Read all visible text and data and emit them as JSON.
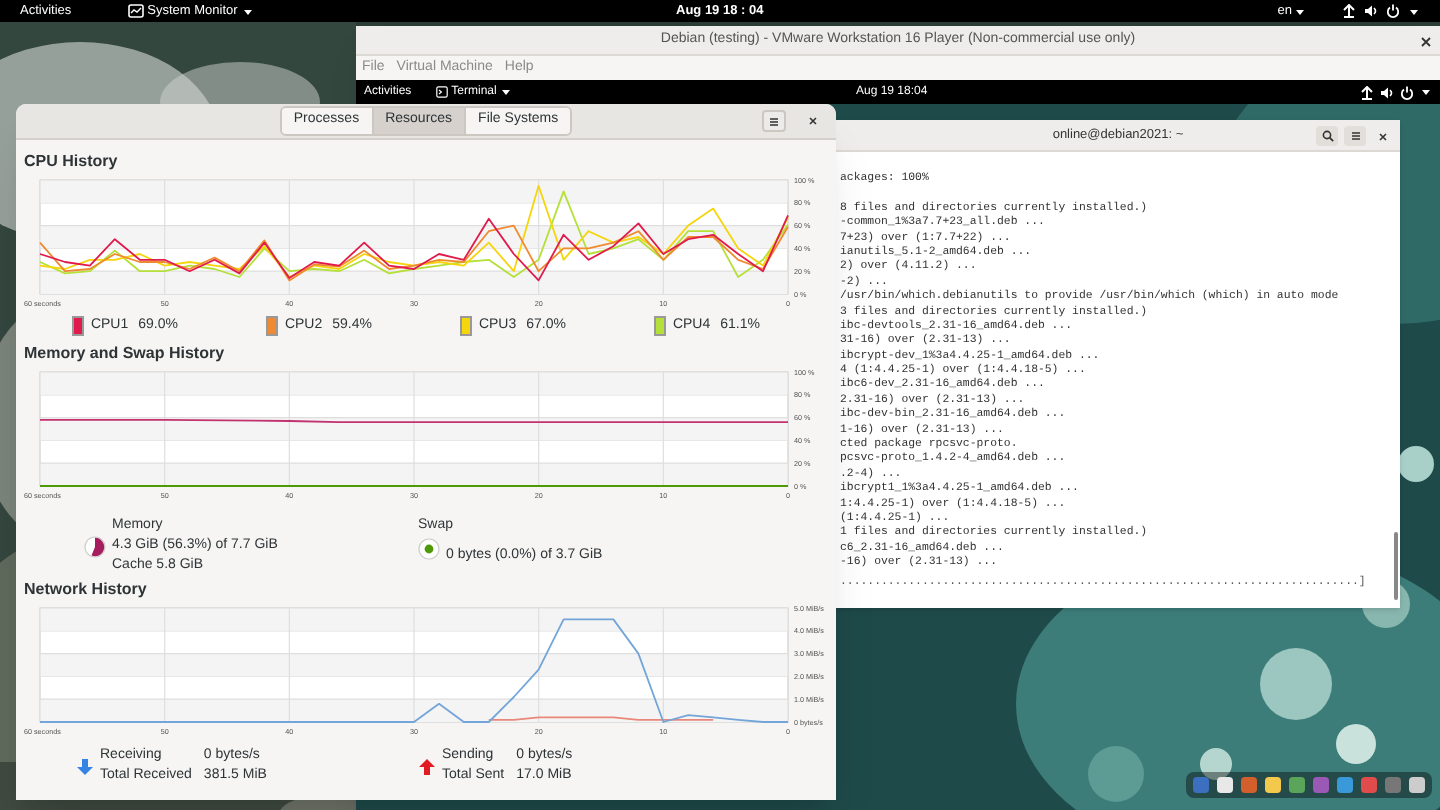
{
  "top_bar": {
    "activities": "Activities",
    "app_menu": "System Monitor",
    "clock": "Aug 19  18 : 04",
    "language": "en"
  },
  "vmware": {
    "title": "Debian (testing) - VMware Workstation 16 Player (Non-commercial use only)",
    "menu": [
      "File",
      "Virtual Machine",
      "Help"
    ],
    "guest_bar": {
      "activities": "Activities",
      "app_menu": "Terminal",
      "clock": "Aug 19  18:04"
    },
    "terminal": {
      "title": "online@debian2021: ~",
      "blocks": [
        [
          "ackages: 100%"
        ],
        [
          "8 files and directories currently installed.)",
          "-common_1%3a7.7+23_all.deb ...",
          "7+23) over (1:7.7+22) ...",
          "ianutils_5.1-2_amd64.deb ...",
          "2) over (4.11.2) ...",
          "-2) ...",
          "/usr/bin/which.debianutils to provide /usr/bin/which (which) in auto mode",
          "3 files and directories currently installed.)",
          "ibc-devtools_2.31-16_amd64.deb ...",
          "31-16) over (2.31-13) ...",
          "ibcrypt-dev_1%3a4.4.25-1_amd64.deb ...",
          "4 (1:4.4.25-1) over (1:4.4.18-5) ...",
          "ibc6-dev_2.31-16_amd64.deb ...",
          "2.31-16) over (2.31-13) ...",
          "ibc-dev-bin_2.31-16_amd64.deb ...",
          "1-16) over (2.31-13) ...",
          "cted package rpcsvc-proto.",
          "pcsvc-proto_1.4.2-4_amd64.deb ...",
          ".2-4) ...",
          "ibcrypt1_1%3a4.4.25-1_amd64.deb ...",
          "1:4.4.25-1) over (1:4.4.18-5) ...",
          "(1:4.4.25-1) ...",
          "1 files and directories currently installed.)",
          "c6_2.31-16_amd64.deb ...",
          "-16) over (2.31-13) ..."
        ]
      ],
      "progress": "............................................................................]"
    }
  },
  "system_monitor": {
    "tabs": [
      {
        "label": "Processes",
        "selected": false
      },
      {
        "label": "Resources",
        "selected": true
      },
      {
        "label": "File Systems",
        "selected": false
      }
    ],
    "cpu": {
      "title": "CPU History",
      "chart_data": {
        "type": "line",
        "grid": true,
        "xlim": [
          60,
          0
        ],
        "ylim": [
          0,
          100
        ],
        "x": [
          60,
          58,
          56,
          54,
          52,
          50,
          48,
          46,
          44,
          42,
          40,
          38,
          36,
          34,
          32,
          30,
          28,
          26,
          24,
          22,
          20,
          18,
          16,
          14,
          12,
          10,
          8,
          6,
          4,
          2,
          0
        ],
        "xticks": [
          {
            "value": 60,
            "label": "60 seconds"
          },
          50,
          40,
          30,
          20,
          10,
          0
        ],
        "yticks": [
          {
            "value": 0,
            "label": "0 %"
          },
          {
            "value": 20,
            "label": "20 %"
          },
          {
            "value": 40,
            "label": "40 %"
          },
          {
            "value": 60,
            "label": "60 %"
          },
          {
            "value": 80,
            "label": "80 %"
          },
          {
            "value": 100,
            "label": "100 %"
          }
        ],
        "series": [
          {
            "color": "#e01b4c",
            "values": [
              35,
              28,
              25,
              48,
              30,
              30,
              20,
              30,
              18,
              45,
              14,
              28,
              25,
              45,
              25,
              22,
              35,
              30,
              66,
              35,
              12,
              52,
              30,
              42,
              62,
              35,
              48,
              52,
              35,
              20,
              69
            ]
          },
          {
            "color": "#f08a30",
            "values": [
              45,
              20,
              22,
              35,
              28,
              28,
              22,
              32,
              20,
              47,
              12,
              26,
              24,
              38,
              22,
              25,
              30,
              28,
              55,
              60,
              20,
              40,
              40,
              45,
              55,
              30,
              50,
              50,
              30,
              22,
              59
            ]
          },
          {
            "color": "#f5d50c",
            "values": [
              25,
              22,
              30,
              30,
              35,
              25,
              28,
              25,
              22,
              42,
              15,
              25,
              22,
              35,
              28,
              25,
              28,
              25,
              45,
              20,
              95,
              30,
              55,
              45,
              50,
              35,
              60,
              75,
              40,
              25,
              67
            ]
          },
          {
            "color": "#b5e03a",
            "values": [
              28,
              18,
              20,
              38,
              20,
              20,
              25,
              22,
              15,
              40,
              20,
              22,
              20,
              30,
              18,
              22,
              25,
              28,
              30,
              15,
              30,
              90,
              35,
              40,
              48,
              30,
              55,
              55,
              15,
              30,
              61
            ]
          }
        ]
      },
      "legend": [
        {
          "label": "CPU1",
          "value": "69.0%",
          "color": "#e01b4c"
        },
        {
          "label": "CPU2",
          "value": "59.4%",
          "color": "#f08a30"
        },
        {
          "label": "CPU3",
          "value": "67.0%",
          "color": "#f5d50c"
        },
        {
          "label": "CPU4",
          "value": "61.1%",
          "color": "#b5e03a"
        }
      ]
    },
    "memory": {
      "title": "Memory and Swap History",
      "chart_data": {
        "type": "line",
        "grid": true,
        "xlim": [
          60,
          0
        ],
        "ylim": [
          0,
          100
        ],
        "x": [
          60,
          50,
          40,
          36,
          30,
          20,
          10,
          0
        ],
        "xticks": [
          {
            "value": 60,
            "label": "60 seconds"
          },
          50,
          40,
          30,
          20,
          10,
          0
        ],
        "yticks": [
          {
            "value": 0,
            "label": "0 %"
          },
          {
            "value": 20,
            "label": "20 %"
          },
          {
            "value": 40,
            "label": "40 %"
          },
          {
            "value": 60,
            "label": "60 %"
          },
          {
            "value": 80,
            "label": "80 %"
          },
          {
            "value": 100,
            "label": "100 %"
          }
        ],
        "series": [
          {
            "color": "#c2326e",
            "values": [
              58,
              58,
              57,
              56,
              56,
              56,
              56,
              56
            ]
          },
          {
            "color": "#4e9a06",
            "values": [
              0,
              0,
              0,
              0,
              0,
              0,
              0,
              0
            ]
          }
        ]
      },
      "memory_info": {
        "label": "Memory",
        "usage": "4.3 GiB (56.3%) of 7.7 GiB",
        "cache": "Cache 5.8 GiB",
        "level": 0.563,
        "color": "#a51d5d"
      },
      "swap_info": {
        "label": "Swap",
        "usage": "0 bytes (0.0%) of 3.7 GiB",
        "color": "#4e9a06"
      }
    },
    "network": {
      "title": "Network History",
      "chart_data": {
        "type": "line",
        "grid": true,
        "xlim": [
          60,
          0
        ],
        "ylim": [
          0,
          5
        ],
        "x": [
          60,
          58,
          56,
          54,
          52,
          50,
          48,
          46,
          44,
          42,
          40,
          38,
          36,
          34,
          32,
          30,
          28,
          26,
          24,
          22,
          20,
          18,
          16,
          14,
          12,
          10,
          8,
          6,
          4,
          2,
          0
        ],
        "xticks": [
          {
            "value": 60,
            "label": "60 seconds"
          },
          50,
          40,
          30,
          20,
          10,
          0
        ],
        "yticks": [
          {
            "value": 0,
            "label": "0 bytes/s"
          },
          {
            "value": 1,
            "label": "1.0 MiB/s"
          },
          {
            "value": 2,
            "label": "2.0 MiB/s"
          },
          {
            "value": 3,
            "label": "3.0 MiB/s"
          },
          {
            "value": 4,
            "label": "4.0 MiB/s"
          },
          {
            "value": 5,
            "label": "5.0 MiB/s"
          }
        ],
        "series": [
          {
            "color": "#73a5d8",
            "values": [
              0,
              0,
              0,
              0,
              0,
              0,
              0,
              0,
              0,
              0,
              0,
              0,
              0,
              0,
              0,
              0,
              0.8,
              0,
              0,
              1.1,
              2.3,
              4.5,
              4.5,
              4.5,
              3.0,
              0,
              0.3,
              0.2,
              0.1,
              0,
              0
            ]
          },
          {
            "color": "#e8877a",
            "values": [
              null,
              null,
              null,
              null,
              null,
              null,
              null,
              null,
              null,
              null,
              null,
              null,
              null,
              null,
              null,
              null,
              null,
              null,
              0.1,
              0.1,
              0.2,
              0.2,
              0.2,
              0.2,
              0.1,
              0.1,
              0.1,
              0.1,
              null,
              null,
              null
            ]
          }
        ]
      },
      "receiving": {
        "label": "Receiving",
        "rate": "0 bytes/s",
        "total_label": "Total Received",
        "total": "381.5 MiB",
        "color": "#3584e4"
      },
      "sending": {
        "label": "Sending",
        "rate": "0 bytes/s",
        "total_label": "Total Sent",
        "total": "17.0 MiB",
        "color": "#e01b24"
      }
    }
  }
}
